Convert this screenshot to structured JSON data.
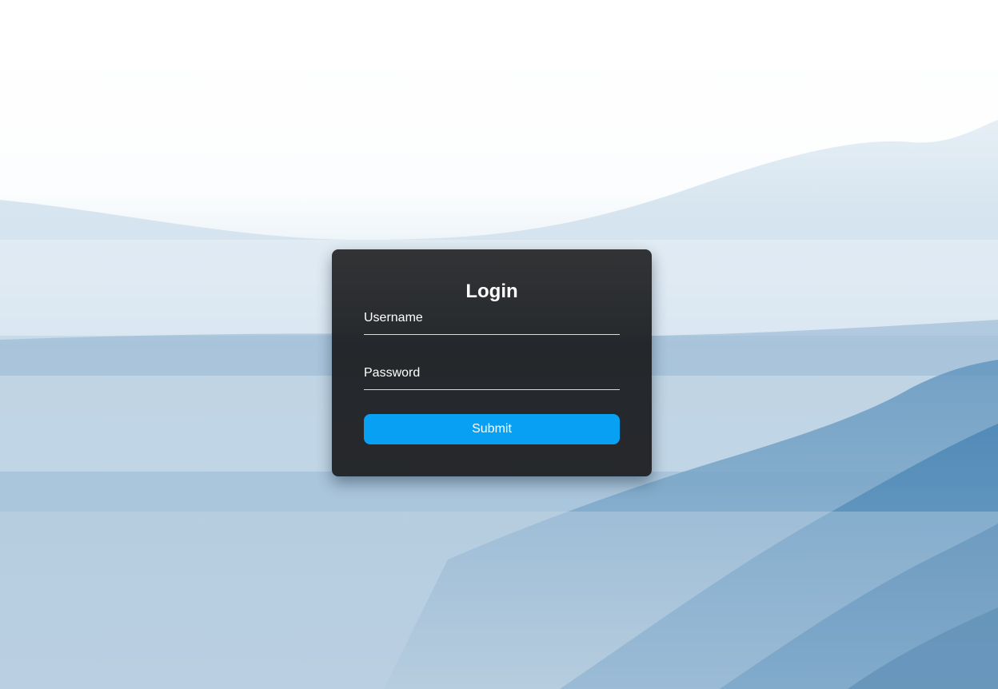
{
  "login": {
    "title": "Login",
    "username_label": "Username",
    "password_label": "Password",
    "submit_label": "Submit"
  },
  "colors": {
    "accent": "#08a0f2",
    "card_background": "#222427",
    "text": "#ffffff"
  },
  "background": {
    "description_icon": "misty-mountains-image"
  }
}
